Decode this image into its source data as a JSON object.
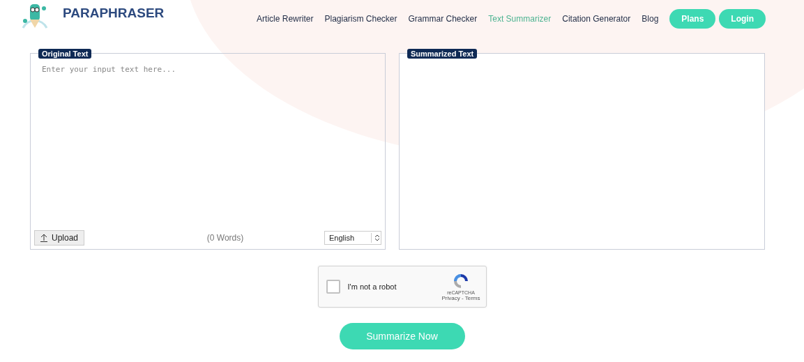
{
  "brand": {
    "name": "PARAPHRASER"
  },
  "nav": [
    {
      "label": "Article Rewriter",
      "selected": false
    },
    {
      "label": "Plagiarism Checker",
      "selected": false
    },
    {
      "label": "Grammar Checker",
      "selected": false
    },
    {
      "label": "Text Summarizer",
      "selected": true
    },
    {
      "label": "Citation Generator",
      "selected": false
    },
    {
      "label": "Blog",
      "selected": false
    }
  ],
  "nav_buttons": [
    "Plans",
    "Login"
  ],
  "input_panel": {
    "title": "Original Text",
    "placeholder": "Enter your input text here...",
    "upload": "Upload",
    "word_count": "(0 Words)",
    "language": "English"
  },
  "output_panel": {
    "title": "Summarized Text"
  },
  "captcha": {
    "label": "I'm not a robot",
    "checked": false,
    "brand": "reCAPTCHA",
    "links": "Privacy - Terms"
  },
  "submit": "Summarize Now"
}
